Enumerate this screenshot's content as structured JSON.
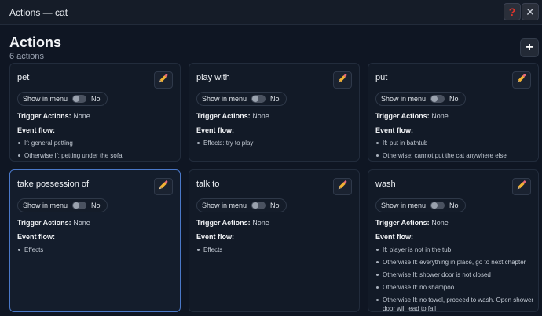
{
  "window": {
    "title": "Actions — cat"
  },
  "header": {
    "title": "Actions",
    "subtitle": "6 actions",
    "add_label": "+"
  },
  "labels": {
    "show_in_menu": "Show in menu",
    "toggle_state": "No",
    "trigger_label": "Trigger Actions:",
    "event_flow_label": "Event flow:"
  },
  "cards": [
    {
      "name": "pet",
      "trigger_value": "None",
      "flow": [
        "If: general petting",
        "Otherwise If: petting under the sofa"
      ]
    },
    {
      "name": "play with",
      "trigger_value": "None",
      "flow": [
        "Effects: try to play"
      ]
    },
    {
      "name": "put",
      "trigger_value": "None",
      "flow": [
        "If: put in bathtub",
        "Otherwise: cannot put the cat anywhere else"
      ]
    },
    {
      "name": "take possession of",
      "trigger_value": "None",
      "flow": [
        "Effects"
      ]
    },
    {
      "name": "talk to",
      "trigger_value": "None",
      "flow": [
        "Effects"
      ]
    },
    {
      "name": "wash",
      "trigger_value": "None",
      "flow": [
        "If: player is not in the tub",
        "Otherwise If: everything in place, go to next chapter",
        "Otherwise If: shower door is not closed",
        "Otherwise If: no shampoo",
        "Otherwise If: no towel, proceed to wash. Open shower door will lead to fail"
      ]
    }
  ],
  "colors": {
    "background": "#0f1623",
    "card": "#121a27",
    "selected_border": "#4a78c8"
  }
}
